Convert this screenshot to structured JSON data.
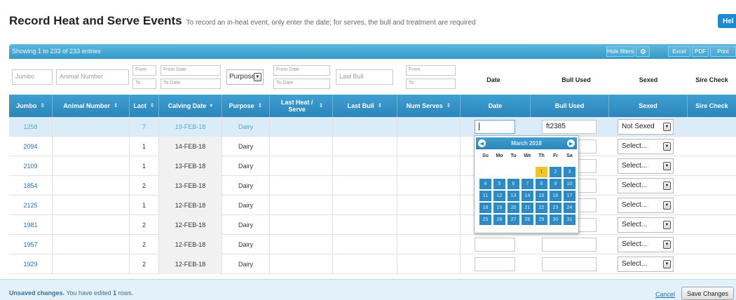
{
  "header": {
    "title": "Record Heat and Serve Events",
    "subtitle": "To record an in-heat event, only enter the date; for serves, the bull and treatment are required",
    "help_label": "Hel"
  },
  "toolbar": {
    "info": "Showing 1 to 233 of 233 entries",
    "hide_filters": "Hide filters",
    "gear_icon": "gear-icon",
    "excel": "Excel",
    "pdf": "PDF",
    "print": "Print"
  },
  "filters": {
    "jumbo_placeholder": "Jumbo",
    "animal_number_placeholder": "Animal Number",
    "lact_from": "From",
    "lact_to": "To",
    "calving_from": "From Date",
    "calving_to": "To Date",
    "purpose_value": "Purpose",
    "last_heat_from": "From Date",
    "last_heat_to": "To Date",
    "last_bull_placeholder": "Last Bull",
    "num_serves_from": "From",
    "num_serves_to": "To",
    "date_header": "Date",
    "bull_used_header": "Bull Used",
    "sexed_header": "Sexed",
    "sire_check_header": "Sire Check"
  },
  "columns": {
    "jumbo": "Jumbo",
    "animal_number": "Animal Number",
    "lact": "Lact",
    "calving_date": "Calving Date",
    "purpose": "Purpose",
    "last_heat_serve": "Last Heat / Serve",
    "last_bull": "Last Bull",
    "num_serves": "Num Serves",
    "date": "Date",
    "bull_used": "Bull Used",
    "sexed": "Sexed",
    "sire_check": "Sire Check"
  },
  "rows": [
    {
      "jumbo": "1258",
      "lact": "7",
      "calving": "19-FEB-18",
      "purpose": "Dairy",
      "bull_used": "ft2385",
      "sexed": "Not Sexed"
    },
    {
      "jumbo": "2094",
      "lact": "1",
      "calving": "14-FEB-18",
      "purpose": "Dairy",
      "bull_used": "",
      "sexed": "Select..."
    },
    {
      "jumbo": "2109",
      "lact": "1",
      "calving": "13-FEB-18",
      "purpose": "Dairy",
      "bull_used": "",
      "sexed": "Select..."
    },
    {
      "jumbo": "1854",
      "lact": "2",
      "calving": "13-FEB-18",
      "purpose": "Dairy",
      "bull_used": "",
      "sexed": "Select..."
    },
    {
      "jumbo": "2125",
      "lact": "1",
      "calving": "12-FEB-18",
      "purpose": "Dairy",
      "bull_used": "",
      "sexed": "Select..."
    },
    {
      "jumbo": "1981",
      "lact": "2",
      "calving": "12-FEB-18",
      "purpose": "Dairy",
      "bull_used": "",
      "sexed": "Select..."
    },
    {
      "jumbo": "1957",
      "lact": "2",
      "calving": "12-FEB-18",
      "purpose": "Dairy",
      "bull_used": "",
      "sexed": "Select..."
    },
    {
      "jumbo": "1929",
      "lact": "2",
      "calving": "12-FEB-18",
      "purpose": "Dairy",
      "bull_used": "",
      "sexed": "Select..."
    }
  ],
  "datepicker": {
    "title": "March 2018",
    "prev_icon": "chevron-left-icon",
    "next_icon": "chevron-right-icon",
    "weekdays": [
      "Su",
      "Mo",
      "Tu",
      "We",
      "Th",
      "Fr",
      "Sa"
    ],
    "days": [
      "1",
      "2",
      "3",
      "4",
      "5",
      "6",
      "7",
      "8",
      "9",
      "10",
      "11",
      "12",
      "13",
      "14",
      "15",
      "16",
      "17",
      "18",
      "19",
      "20",
      "21",
      "22",
      "23",
      "24",
      "25",
      "26",
      "27",
      "28",
      "29",
      "30",
      "31"
    ],
    "today": "1"
  },
  "footer": {
    "unsaved_bold": "Unsaved changes.",
    "unsaved_prefix": " You have edited ",
    "unsaved_count": "1",
    "unsaved_suffix": " rows.",
    "cancel": "Cancel",
    "save": "Save Changes"
  }
}
